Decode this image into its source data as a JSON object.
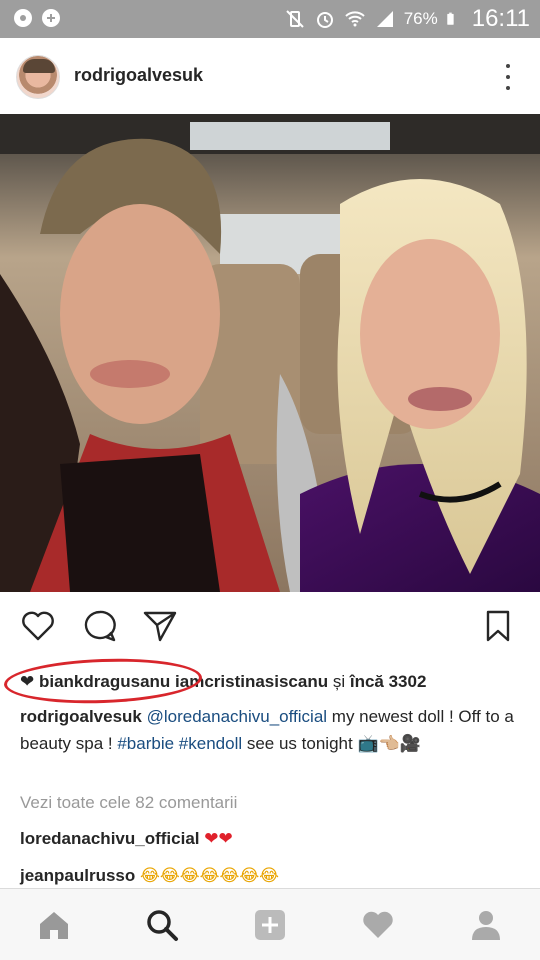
{
  "status_bar": {
    "battery": "76%",
    "time": "16:11"
  },
  "post": {
    "username": "rodrigoalvesuk",
    "likes": {
      "liker1": "biankdragusanu",
      "liker2": "iamcristinasiscanu",
      "connector": " și ",
      "more": "încă 3302"
    },
    "caption": {
      "author": "rodrigoalvesuk",
      "mention": "@loredanachivu_official",
      "text1": " my newest doll ! Off to a beauty spa ! ",
      "hashtag1": "#barbie",
      "hashtag2": "#kendoll",
      "text2": " see us tonight ",
      "emojis": "📺👈🏼🎥"
    },
    "view_all_comments": "Vezi toate cele 82 comentarii",
    "comments": [
      {
        "user": "loredanachivu_official",
        "text": "❤❤"
      },
      {
        "user": "jeanpaulrusso",
        "text": "😂😂😂😂😂😂😂"
      }
    ]
  },
  "icons": {
    "like": "heart-outline-icon",
    "comment": "comment-bubble-icon",
    "share": "paper-plane-icon",
    "save": "bookmark-icon",
    "home": "home-icon",
    "search": "search-icon",
    "add": "add-post-icon",
    "activity": "heart-icon",
    "profile": "profile-icon"
  },
  "colors": {
    "status_bar": "#9e9e9e",
    "link": "#1a4d80",
    "annotation_ellipse": "#d8262c"
  }
}
